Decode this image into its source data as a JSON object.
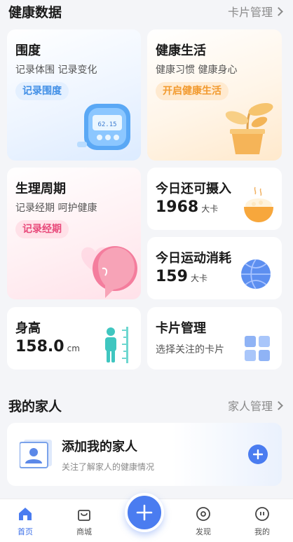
{
  "health": {
    "title": "健康数据",
    "manage_link": "卡片管理"
  },
  "cards": {
    "girth": {
      "title": "围度",
      "subtitle": "记录体围 记录变化",
      "action": "记录围度",
      "scale_reading": "62.15"
    },
    "life": {
      "title": "健康生活",
      "subtitle": "健康习惯 健康身心",
      "action": "开启健康生活"
    },
    "period": {
      "title": "生理周期",
      "subtitle": "记录经期 呵护健康",
      "action": "记录经期"
    },
    "intake": {
      "title": "今日还可摄入",
      "value": "1968",
      "unit": "大卡"
    },
    "exercise": {
      "title": "今日运动消耗",
      "value": "159",
      "unit": "大卡"
    },
    "height": {
      "title": "身高",
      "value": "158.0",
      "unit": "cm"
    },
    "card_manage": {
      "title": "卡片管理",
      "subtitle": "选择关注的卡片"
    }
  },
  "family": {
    "title": "我的家人",
    "manage_link": "家人管理",
    "add_title": "添加我的家人",
    "add_subtitle": "关注了解家人的健康情况"
  },
  "tabbar": {
    "tabs": [
      {
        "label": "首页",
        "icon": "home-icon",
        "active": true
      },
      {
        "label": "商城",
        "icon": "shopping-bag-icon",
        "active": false
      },
      {
        "label": "发现",
        "icon": "discover-icon",
        "active": false
      },
      {
        "label": "我的",
        "icon": "profile-icon",
        "active": false
      }
    ],
    "fab_icon": "plus-icon"
  },
  "colors": {
    "accent": "#4a7cf0",
    "orange": "#f29a2e",
    "pink": "#e8497a",
    "blue_text": "#3f8ee6"
  }
}
